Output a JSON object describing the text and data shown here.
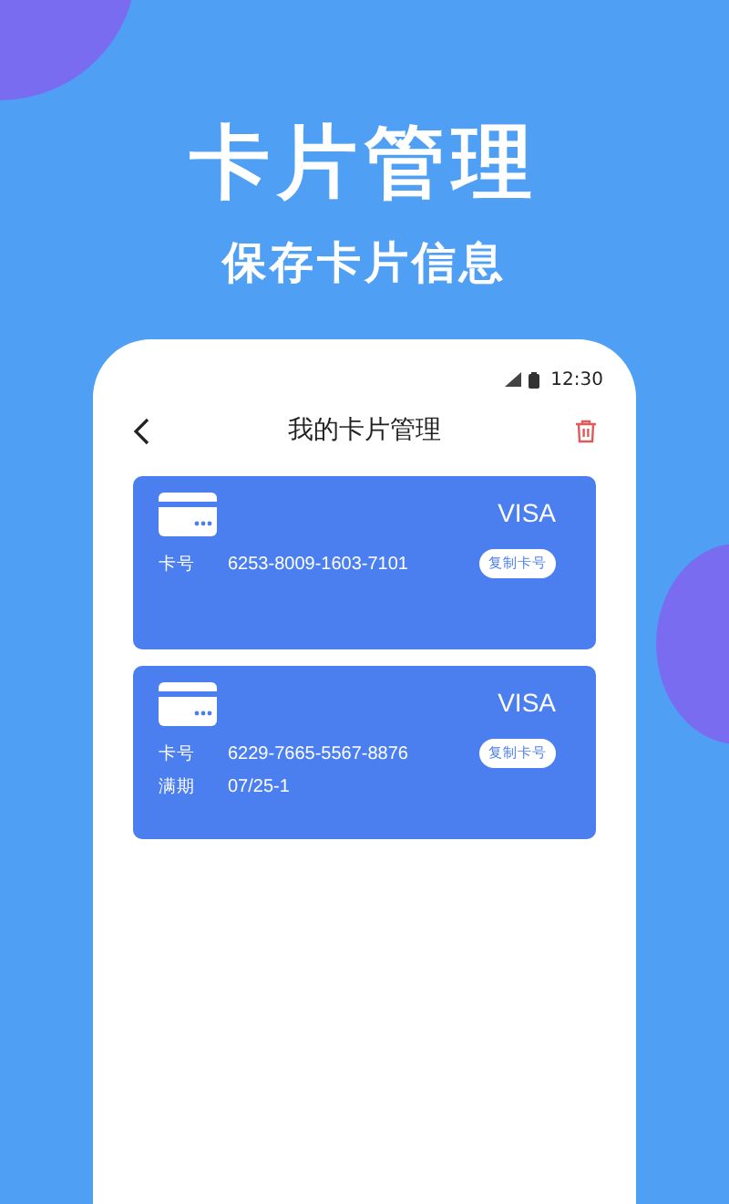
{
  "hero": {
    "title": "卡片管理",
    "subtitle": "保存卡片信息"
  },
  "status_bar": {
    "time": "12:30"
  },
  "header": {
    "title": "我的卡片管理"
  },
  "cards": [
    {
      "brand": "VISA",
      "copy_button": "复制卡号",
      "fields": [
        {
          "label": "卡号",
          "value": "6253-8009-1603-7101"
        }
      ]
    },
    {
      "brand": "VISA",
      "copy_button": "复制卡号",
      "fields": [
        {
          "label": "卡号",
          "value": "6229-7665-5567-8876"
        },
        {
          "label": "满期",
          "value": "07/25-1"
        }
      ]
    }
  ]
}
